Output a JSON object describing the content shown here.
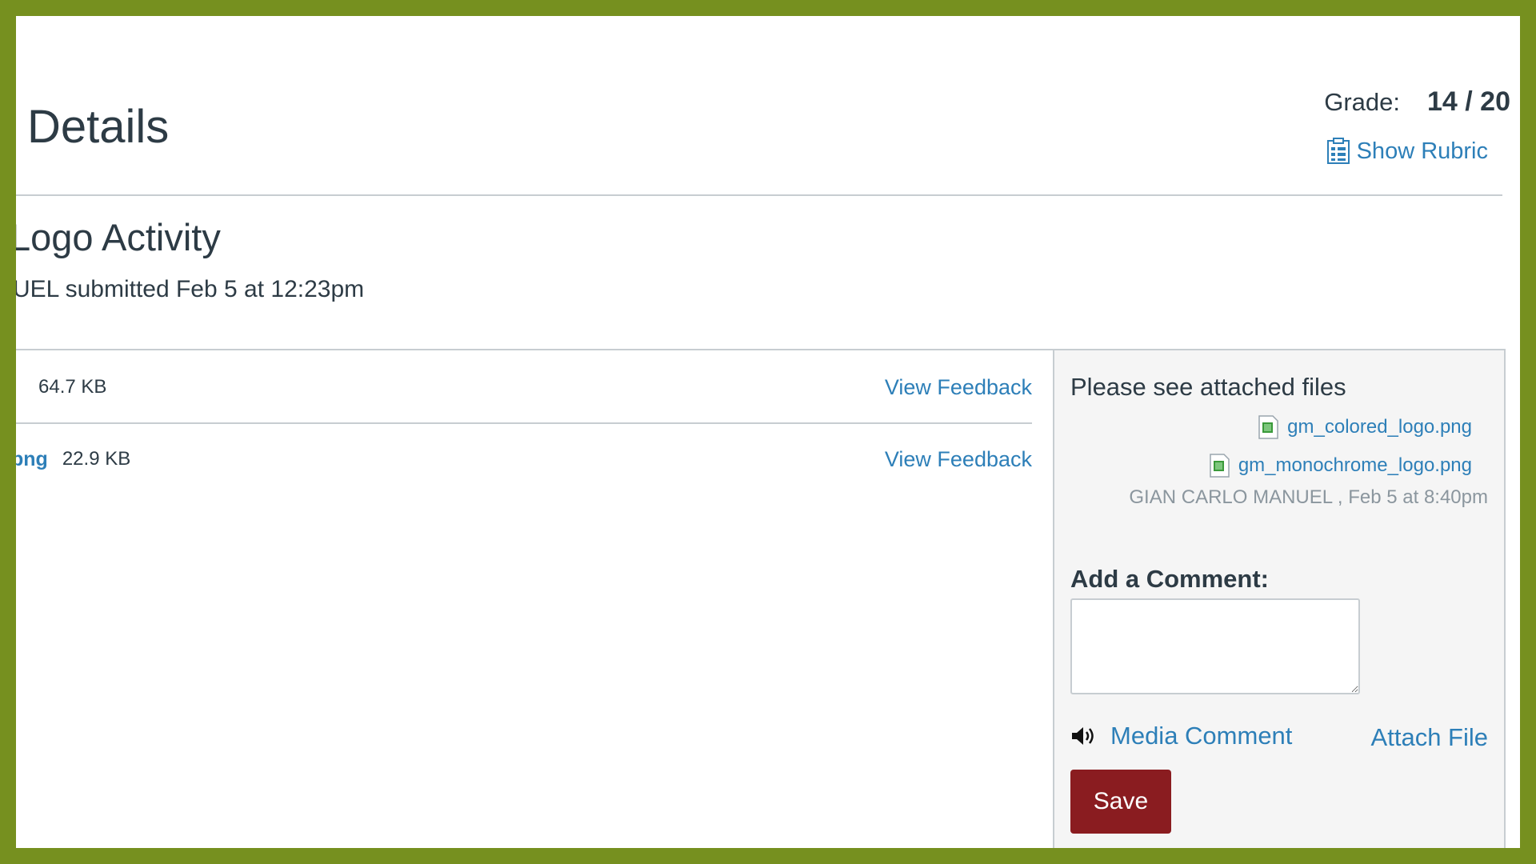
{
  "header": {
    "title": "Details",
    "grade_label": "Grade:",
    "grade_value": "14 / 20",
    "show_rubric_label": "Show Rubric"
  },
  "assignment": {
    "title": "Logo Activity",
    "submitted_text": "UEL submitted Feb 5 at 12:23pm"
  },
  "files": [
    {
      "name": "",
      "size": "64.7 KB",
      "action": "View Feedback"
    },
    {
      "name": "png",
      "size": "22.9 KB",
      "action": "View Feedback"
    }
  ],
  "comments": {
    "text": "Please see attached files",
    "attachments": [
      "gm_colored_logo.png",
      "gm_monochrome_logo.png"
    ],
    "author_line": "GIAN CARLO MANUEL , Feb 5 at 8:40pm",
    "add_label": "Add a Comment:",
    "input_value": "",
    "media_label": "Media Comment",
    "attach_label": "Attach File",
    "save_label": "Save"
  },
  "colors": {
    "border": "#76901f",
    "link": "#2d7fb8",
    "save_button": "#8a1c20",
    "text": "#2d3b45"
  },
  "icons": [
    "rubric-icon",
    "image-file-icon",
    "speaker-icon"
  ]
}
